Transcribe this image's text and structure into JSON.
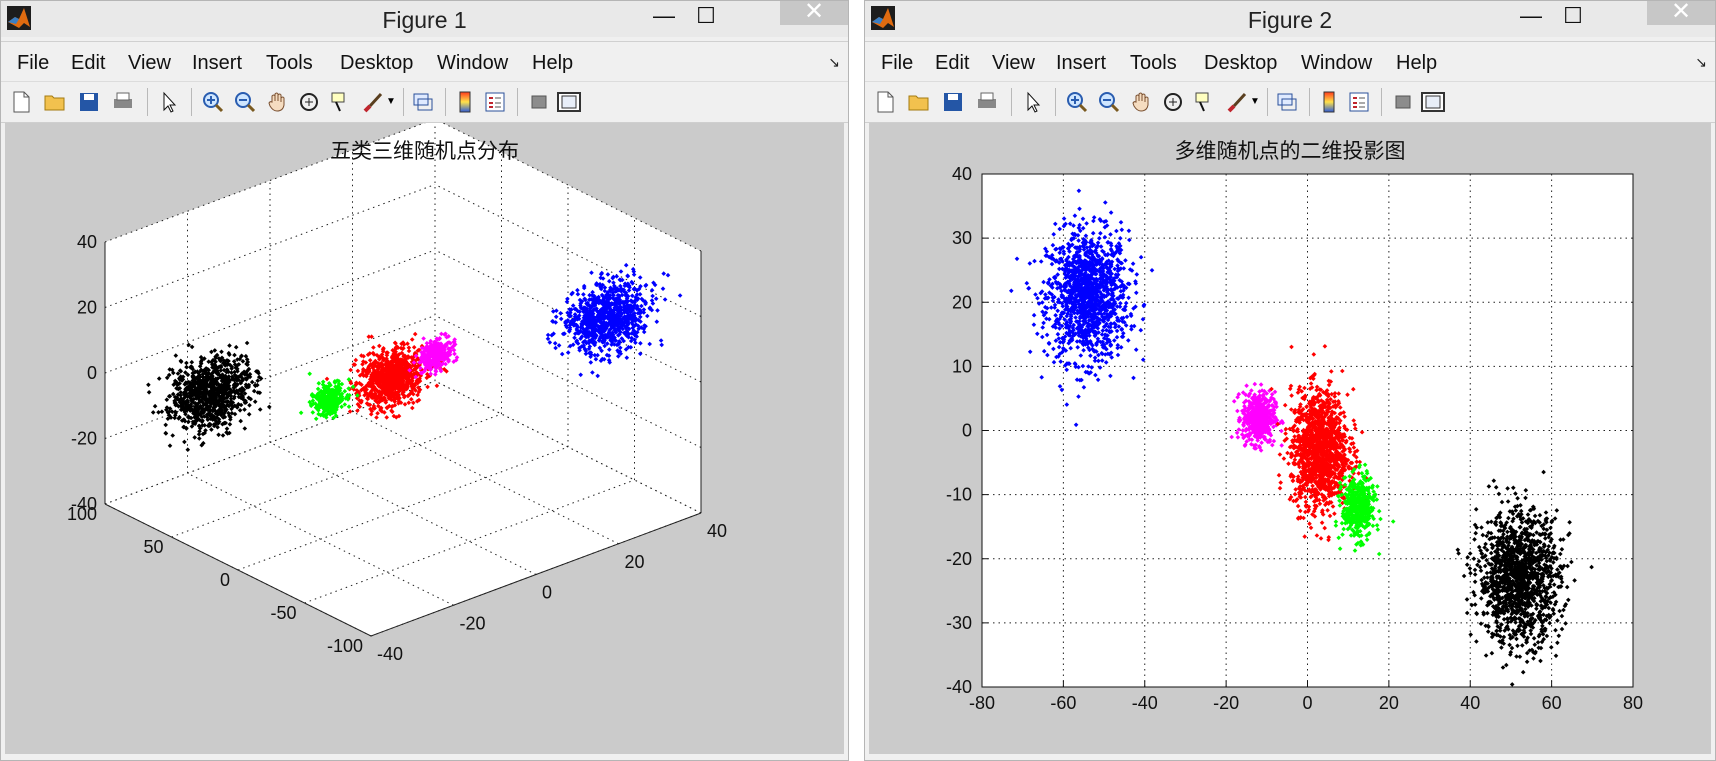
{
  "windows": [
    {
      "title": "Figure 1",
      "controls": {
        "minimize": "—",
        "maximize": "☐",
        "close": "✕"
      },
      "menu": [
        "File",
        "Edit",
        "View",
        "Insert",
        "Tools",
        "Desktop",
        "Window",
        "Help"
      ],
      "menu_arrow": "↘",
      "toolbar_icons": [
        "new-figure-icon",
        "open-file-icon",
        "save-icon",
        "print-icon",
        "pointer-icon",
        "zoom-in-icon",
        "zoom-out-icon",
        "pan-icon",
        "rotate-3d-icon",
        "data-cursor-icon",
        "brush-icon",
        "link-plot-icon",
        "colorbar-icon",
        "legend-icon",
        "hide-plot-tools-icon",
        "show-plot-tools-icon"
      ],
      "figure_title": "五类三维随机点分布"
    },
    {
      "title": "Figure 2",
      "controls": {
        "minimize": "—",
        "maximize": "☐",
        "close": "✕"
      },
      "menu": [
        "File",
        "Edit",
        "View",
        "Insert",
        "Tools",
        "Desktop",
        "Window",
        "Help"
      ],
      "menu_arrow": "↘",
      "toolbar_icons": [
        "new-figure-icon",
        "open-file-icon",
        "save-icon",
        "print-icon",
        "pointer-icon",
        "zoom-in-icon",
        "zoom-out-icon",
        "pan-icon",
        "rotate-3d-icon",
        "data-cursor-icon",
        "brush-icon",
        "link-plot-icon",
        "colorbar-icon",
        "legend-icon",
        "hide-plot-tools-icon",
        "show-plot-tools-icon"
      ],
      "figure_title": "多维随机点的二维投影图"
    }
  ],
  "chart_data": [
    {
      "type": "scatter",
      "title": "五类三维随机点分布",
      "projection": "3d",
      "xlim": [
        -40,
        40
      ],
      "ylim": [
        -100,
        100
      ],
      "zlim": [
        -40,
        40
      ],
      "xticks": [
        "-40",
        "-20",
        "0",
        "20",
        "40"
      ],
      "yticks": [
        "-100",
        "-50",
        "0",
        "50",
        "100"
      ],
      "zticks": [
        "-40",
        "-20",
        "0",
        "20",
        "40"
      ],
      "grid": true,
      "series": [
        {
          "color": "#0000ff",
          "center": [
            -55,
            22,
            25
          ],
          "spread": [
            5,
            5,
            5
          ]
        },
        {
          "color": "#ff0000",
          "center": [
            2,
            -2,
            0
          ],
          "spread": [
            4,
            4,
            4
          ]
        },
        {
          "color": "#ff00ff",
          "center": [
            -12,
            2,
            10
          ],
          "spread": [
            2,
            2,
            2
          ]
        },
        {
          "color": "#00ff00",
          "center": [
            12,
            -12,
            -5
          ],
          "spread": [
            2,
            2,
            2
          ]
        },
        {
          "color": "#000000",
          "center": [
            50,
            -22,
            -10
          ],
          "spread": [
            5,
            5,
            5
          ]
        }
      ]
    },
    {
      "type": "scatter",
      "title": "多维随机点的二维投影图",
      "xlim": [
        -80,
        80
      ],
      "ylim": [
        -40,
        40
      ],
      "xticks": [
        "-80",
        "-60",
        "-40",
        "-20",
        "0",
        "20",
        "40",
        "60",
        "80"
      ],
      "yticks": [
        "-40",
        "-30",
        "-20",
        "-10",
        "0",
        "10",
        "20",
        "30",
        "40"
      ],
      "grid": true,
      "series": [
        {
          "color": "#0000ff",
          "center": [
            -54,
            21
          ],
          "spread": [
            5,
            5
          ],
          "count": 1300
        },
        {
          "color": "#ff00ff",
          "center": [
            -12,
            2
          ],
          "spread": [
            2,
            2
          ],
          "count": 500
        },
        {
          "color": "#ff0000",
          "center": [
            3,
            -3
          ],
          "spread": [
            3.5,
            4.5
          ],
          "count": 1300
        },
        {
          "color": "#00ff00",
          "center": [
            12.5,
            -12
          ],
          "spread": [
            2,
            2.4
          ],
          "count": 450
        },
        {
          "color": "#000000",
          "center": [
            52,
            -23
          ],
          "spread": [
            5,
            5
          ],
          "count": 1300
        }
      ]
    }
  ]
}
